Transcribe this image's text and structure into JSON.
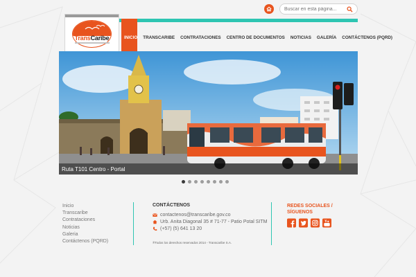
{
  "header": {
    "home_icon": "home-icon",
    "search_placeholder": "Buscar en esta página...",
    "search_icon": "search-icon"
  },
  "logo": {
    "brand_orange": "Trans",
    "brand_dark": "Caribe"
  },
  "nav": {
    "items": [
      {
        "label": "INICIO",
        "active": true
      },
      {
        "label": "TRANSCARIBE",
        "active": false
      },
      {
        "label": "CONTRATACIONES",
        "active": false
      },
      {
        "label": "CENTRO DE DOCUMENTOS",
        "active": false
      },
      {
        "label": "NOTICIAS",
        "active": false
      },
      {
        "label": "GALERÍA",
        "active": false
      },
      {
        "label": "CONTÁCTENOS (PQRD)",
        "active": false
      }
    ]
  },
  "slider": {
    "caption": "Ruta T101 Centro - Portal",
    "slide_count": 8,
    "active_slide": 1
  },
  "footer": {
    "links": [
      "Inicio",
      "Transcaribe",
      "Contrataciones",
      "Noticias",
      "Galeria",
      "Contáctenos (PQRD)"
    ],
    "contact_title": "CONTÁCTENOS",
    "email": "contactenos@transcaribe.gov.co",
    "address": "Urb. Anita Diagonal 35 # 71-77 - Patio Potal SITM",
    "phone": "(+57) (5) 641 13 20",
    "copyright": "®Todos los derechos reservados 2014 - Transcaribe S.A.",
    "social_title_1": "REDES SOCIALES /",
    "social_title_2": "SÍGUENOS",
    "social_icons": [
      "facebook-icon",
      "twitter-icon",
      "instagram-icon",
      "youtube-icon"
    ]
  },
  "colors": {
    "brand_orange": "#e8541e",
    "accent_teal": "#2ec5b2",
    "page_bg": "#f3f3f3"
  }
}
